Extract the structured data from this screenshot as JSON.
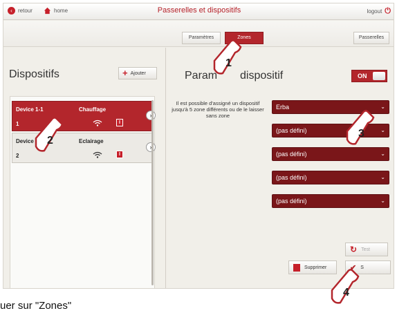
{
  "topbar": {
    "back_label": "retour",
    "home_label": "home",
    "title": "Passerelles et dispositifs",
    "logout_label": "logout"
  },
  "subbar": {
    "tab_parametres": "Paramètres",
    "tab_zones": "Zones",
    "passerelles_label": "Passerelles"
  },
  "left": {
    "heading": "Dispositifs",
    "add_label": "Ajouter",
    "devices": [
      {
        "name": "Device 1-1",
        "type": "Chauffage",
        "id": "1",
        "badge": "I",
        "selected": true
      },
      {
        "name": "Device 1-",
        "type": "Eclairage",
        "id": "2",
        "badge": "I",
        "selected": false
      }
    ]
  },
  "right": {
    "heading_part1": "Param",
    "heading_part2": "dispositif",
    "toggle_label": "ON",
    "hint": "Il est possible d'assigné un dispositif jusqu'à 5 zone différents ou de le laisser sans zone",
    "zones": [
      "Erba",
      "(pas défini)",
      "(pas défini)",
      "(pas défini)",
      "(pas défini)"
    ],
    "test_label": "Test",
    "delete_label": "Supprimer",
    "save_label": "S"
  },
  "callouts": [
    "1",
    "2",
    "3",
    "4"
  ],
  "caption": "uer sur \"Zones\"",
  "colors": {
    "accent": "#b3262c",
    "dark_select": "#7a1619"
  }
}
